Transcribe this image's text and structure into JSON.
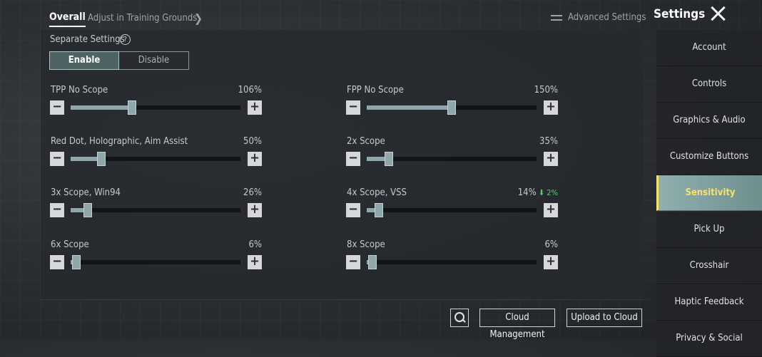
{
  "header": {
    "tab_overall": "Overall",
    "tab_adjust": "Adjust in Training Grounds",
    "advanced": "Advanced Settings"
  },
  "sidebar": {
    "title": "Settings",
    "items": [
      {
        "label": "Account"
      },
      {
        "label": "Controls"
      },
      {
        "label": "Graphics & Audio"
      },
      {
        "label": "Customize Buttons"
      },
      {
        "label": "Sensitivity",
        "active": true
      },
      {
        "label": "Pick Up"
      },
      {
        "label": "Crosshair"
      },
      {
        "label": "Haptic Feedback"
      },
      {
        "label": "Privacy & Social"
      }
    ]
  },
  "separate": {
    "label": "Separate Settings",
    "help": "?",
    "enable": "Enable",
    "disable": "Disable",
    "selected": "Enable"
  },
  "sensitivities": [
    {
      "label": "TPP No Scope",
      "value": "106%",
      "level": 0.36
    },
    {
      "label": "FPP No Scope",
      "value": "150%",
      "level": 0.5
    },
    {
      "label": "Red Dot, Holographic, Aim Assist",
      "value": "50%",
      "level": 0.18
    },
    {
      "label": "2x Scope",
      "value": "35%",
      "level": 0.13
    },
    {
      "label": "3x Scope, Win94",
      "value": "26%",
      "level": 0.1
    },
    {
      "label": "4x Scope, VSS",
      "value": "14%",
      "change": "2%",
      "level": 0.07
    },
    {
      "label": "6x Scope",
      "value": "6%",
      "level": 0.035
    },
    {
      "label": "8x Scope",
      "value": "6%",
      "level": 0.035
    }
  ],
  "footer": {
    "cloud_management": "Cloud Management",
    "upload": "Upload to Cloud"
  },
  "colors": {
    "accent": "#f6e36a",
    "active_tab_bg": "#8fb0ae",
    "slider": "#8fa7ab",
    "positive_change": "#4fcf78"
  },
  "icons": {
    "help": "question-circle-icon",
    "advanced": "sliders-icon",
    "search": "search-icon",
    "close": "close-icon",
    "change": "arrow-down-icon"
  }
}
